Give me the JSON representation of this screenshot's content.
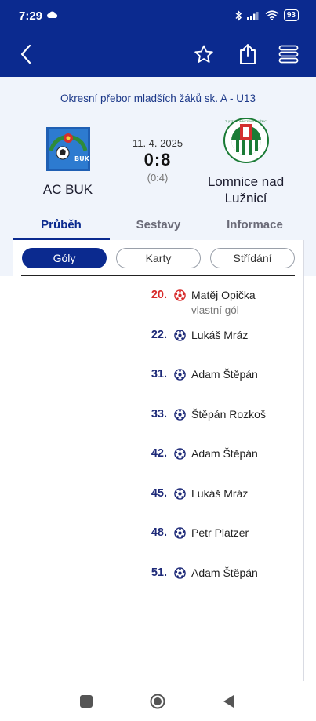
{
  "status_bar": {
    "time": "7:29",
    "battery": "93"
  },
  "app_bar": {
    "back_icon": "chevron-left-icon",
    "favorite_icon": "star-icon",
    "share_icon": "share-icon",
    "menu_icon": "hamburger-menu-icon"
  },
  "match": {
    "competition": "Okresní přebor mladších žáků sk. A - U13",
    "date": "11. 4. 2025",
    "score": "0:8",
    "halftime": "(0:4)",
    "home_team": {
      "name": "AC BUK",
      "logo_text": "BUK"
    },
    "away_team": {
      "name": "Lomnice nad Lužnicí",
      "logo_text": "TJ JITEX LOMNICE NAD LUŽNICÍ"
    }
  },
  "tabs": [
    {
      "label": "Průběh",
      "active": true
    },
    {
      "label": "Sestavy",
      "active": false
    },
    {
      "label": "Informace",
      "active": false
    }
  ],
  "filters": [
    {
      "label": "Góly",
      "active": true
    },
    {
      "label": "Karty",
      "active": false
    },
    {
      "label": "Střídání",
      "active": false
    }
  ],
  "goals": [
    {
      "minute": "20.",
      "player": "Matěj Opička",
      "note": "vlastní gól",
      "own_goal": true
    },
    {
      "minute": "22.",
      "player": "Lukáš Mráz",
      "note": "",
      "own_goal": false
    },
    {
      "minute": "31.",
      "player": "Adam Štěpán",
      "note": "",
      "own_goal": false
    },
    {
      "minute": "33.",
      "player": "Štěpán Rozkoš",
      "note": "",
      "own_goal": false
    },
    {
      "minute": "42.",
      "player": "Adam Štěpán",
      "note": "",
      "own_goal": false
    },
    {
      "minute": "45.",
      "player": "Lukáš Mráz",
      "note": "",
      "own_goal": false
    },
    {
      "minute": "48.",
      "player": "Petr Platzer",
      "note": "",
      "own_goal": false
    },
    {
      "minute": "51.",
      "player": "Adam Štěpán",
      "note": "",
      "own_goal": false
    }
  ],
  "colors": {
    "brand": "#0b2a8f",
    "own_goal": "#d72a2a",
    "header_bg": "#f0f4fb"
  }
}
